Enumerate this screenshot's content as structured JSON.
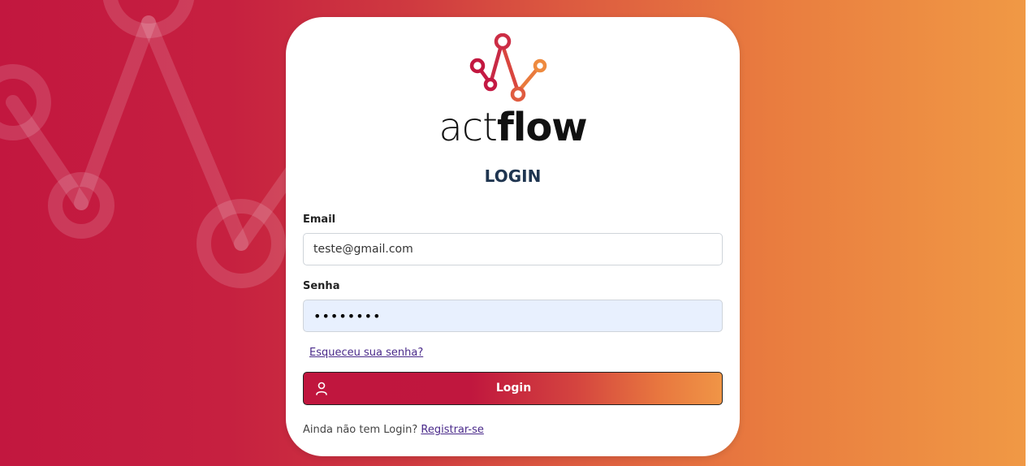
{
  "brand": {
    "name_light": "act",
    "name_bold": "flow",
    "colors": {
      "accent_start": "#c2173f",
      "accent_end": "#f09945",
      "link": "#4a2a8a",
      "title": "#1f3550"
    }
  },
  "login_form": {
    "title": "LOGIN",
    "email": {
      "label": "Email",
      "value": "teste@gmail.com"
    },
    "password": {
      "label": "Senha",
      "value": "••••••••"
    },
    "forgot_link": "Esqueceu sua senha?",
    "submit": {
      "label": "Login",
      "icon": "user-icon"
    },
    "register": {
      "prompt": "Ainda não tem Login?",
      "link": "Registrar-se"
    }
  }
}
